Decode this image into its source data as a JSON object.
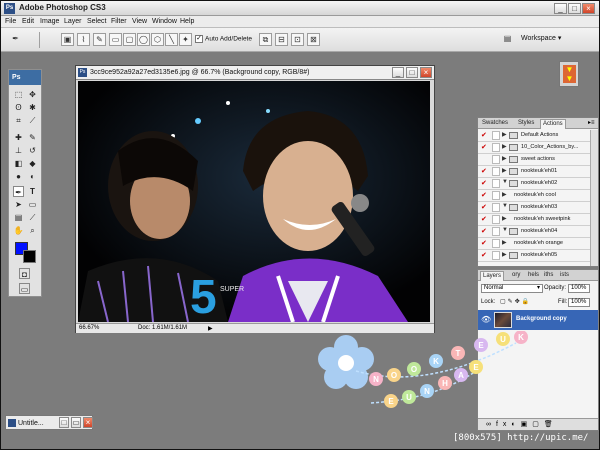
{
  "app": {
    "title": "Adobe Photoshop CS3",
    "logo": "Ps"
  },
  "menu": [
    "File",
    "Edit",
    "Image",
    "Layer",
    "Select",
    "Filter",
    "View",
    "Window",
    "Help"
  ],
  "options": {
    "auto_add_delete": "Auto Add/Delete",
    "auto_add_checked": true,
    "workspace": "Workspace"
  },
  "tools": {
    "header": "Ps",
    "foreground_color": "#0010ff",
    "background_color": "#000000"
  },
  "document": {
    "title": "3cc9ce952a92a27ed3135e6.jpg @ 66.7% (Background copy, RGB/8#)",
    "zoom": "66.67%",
    "doc_info": "Doc: 1.61M/1.61M",
    "canvas_text_50": "5",
    "canvas_text_small": "SUPER"
  },
  "actions_panel": {
    "tabs": [
      "Swatches",
      "Styles",
      "Actions"
    ],
    "active_tab": "Actions",
    "rows": [
      {
        "label": "Default Actions",
        "checked": true,
        "arrow": "▶",
        "folder": true
      },
      {
        "label": "10_Color_Actions_by...",
        "checked": true,
        "arrow": "▶",
        "folder": true
      },
      {
        "label": "sweet actions",
        "checked": false,
        "arrow": "▶",
        "folder": true
      },
      {
        "label": "nookteuk'eh01",
        "checked": true,
        "arrow": "▶",
        "folder": true
      },
      {
        "label": "nookteuk'eh02",
        "checked": true,
        "arrow": "▼",
        "folder": true
      },
      {
        "label": "nookteuk'eh cool",
        "checked": true,
        "arrow": "▶",
        "folder": false
      },
      {
        "label": "nookteuk'eh03",
        "checked": true,
        "arrow": "▼",
        "folder": true
      },
      {
        "label": "nookteuk'eh sweetpink",
        "checked": true,
        "arrow": "▶",
        "folder": false
      },
      {
        "label": "nookteuk'eh04",
        "checked": true,
        "arrow": "▼",
        "folder": true
      },
      {
        "label": "nookteuk'eh orange",
        "checked": true,
        "arrow": "▶",
        "folder": false
      },
      {
        "label": "nookteuk'eh05",
        "checked": true,
        "arrow": "▶",
        "folder": true
      }
    ]
  },
  "layers_panel": {
    "tabs": [
      "Layers",
      "ory",
      "hels",
      "iths",
      "ists"
    ],
    "blend_mode": "Normal",
    "opacity_label": "Opacity:",
    "opacity": "100%",
    "lock_label": "Lock:",
    "fill_label": "Fill:",
    "fill": "100%",
    "layer_name": "Background copy"
  },
  "minimized_doc": {
    "title": "Untitle..."
  },
  "decoration": {
    "letters": [
      "N",
      "O",
      "O",
      "K",
      "T",
      "E",
      "U",
      "K",
      "E",
      "U",
      "N",
      "H",
      "A",
      "E"
    ]
  },
  "watermark": "[800x575] http://upic.me/"
}
